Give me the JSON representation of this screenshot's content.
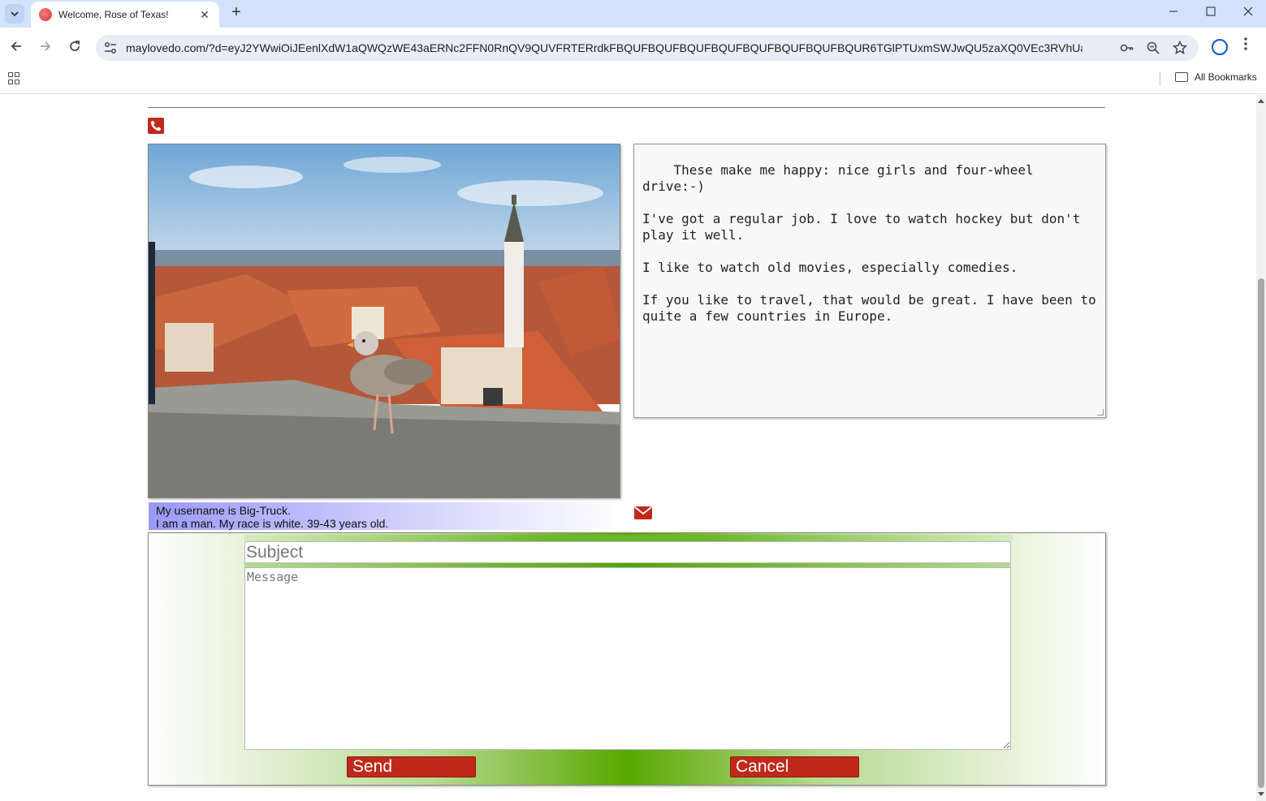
{
  "browser": {
    "tab_title": "Welcome, Rose of Texas!",
    "url": "maylovedo.com/?d=eyJ2YWwiOiJEenlXdW1aQWQzWE43aERNc2FFN0RnQV9QUVFRTERrdkFBQUFBQUFBQUFBQUFBQUFBQUFBQUFBQUR6TGlPTUxmSWJwQU5zaXQ0VEc3RVhUaEk1eHVOa2RfSlhtZWc2...",
    "bookmarks_label": "All Bookmarks",
    "new_tab_glyph": "+",
    "close_glyph": "✕"
  },
  "profile": {
    "about_text": "These make me happy: nice girls and four-wheel drive:-)\n\nI've got a regular job. I love to watch hockey but don't play it well.\n\nI like to watch old movies, especially comedies.\n\nIf you like to travel, that would be great. I have been to quite a few countries in Europe.",
    "username_line": "My username is Big-Truck.",
    "details_line": "I am a man. My race is white. 39-43 years old."
  },
  "message_form": {
    "subject_placeholder": "Subject",
    "message_placeholder": "Message",
    "send_label": "Send",
    "cancel_label": "Cancel"
  },
  "colors": {
    "accent_red": "#c0291a",
    "panel_green": "#58a800",
    "info_purple": "#9a9af7"
  },
  "icons": [
    "phone-icon",
    "mail-icon",
    "back-icon",
    "forward-icon",
    "reload-icon",
    "key-icon",
    "zoom-icon",
    "star-icon",
    "profile-icon",
    "menu-icon",
    "apps-icon",
    "folder-icon"
  ]
}
